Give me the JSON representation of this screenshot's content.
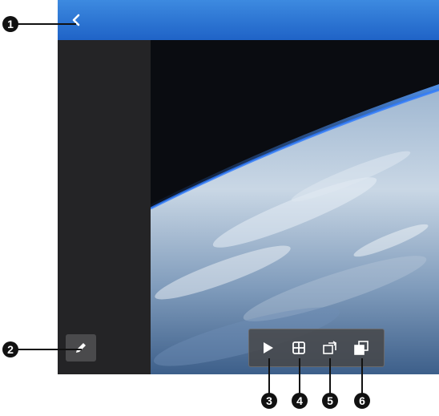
{
  "callouts": [
    "1",
    "2",
    "3",
    "4",
    "5",
    "6"
  ],
  "icons": {
    "back": "chevron-left-icon",
    "edit": "pencil-icon",
    "play": "play-icon",
    "grid": "grid-icon",
    "set_wallpaper": "set-wallpaper-icon",
    "copy": "copy-icon"
  },
  "colors": {
    "topbar": "#2a73d6",
    "screen_bg": "#111215",
    "side_panel": "#242426",
    "toolbar": "#464648"
  }
}
